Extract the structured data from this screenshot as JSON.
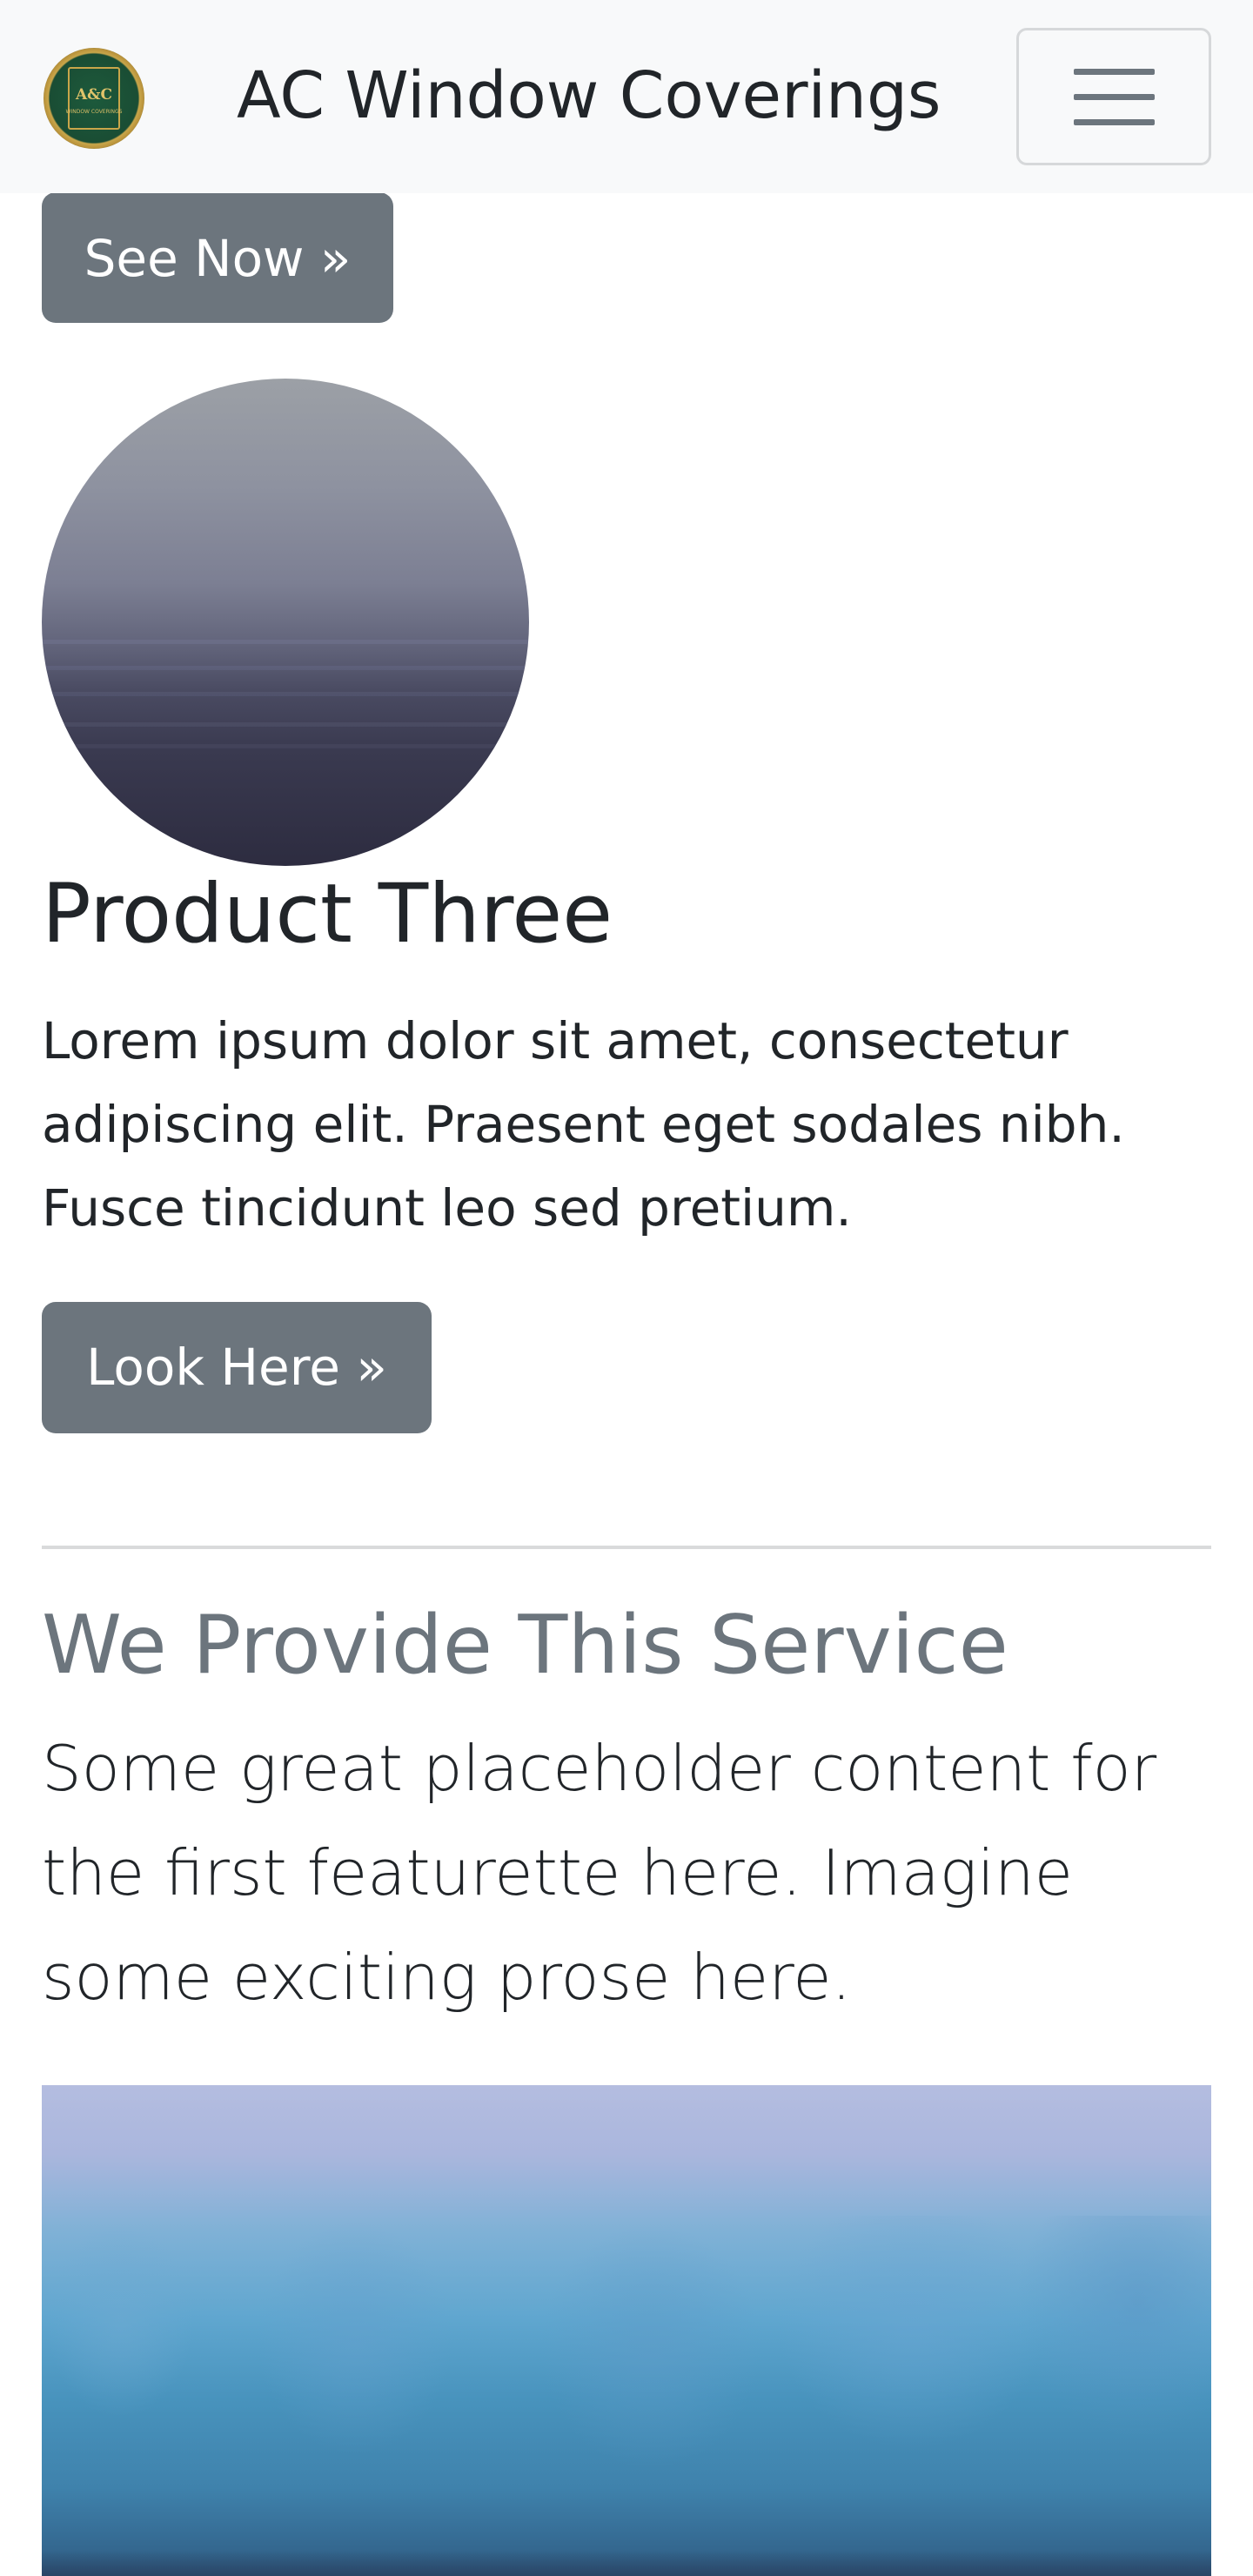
{
  "navbar": {
    "brand_name": "AC Window Coverings",
    "logo": {
      "text": "A&C",
      "subtext": "WINDOW COVERINGS"
    },
    "toggler_icon": "hamburger-menu-icon"
  },
  "buttons": {
    "see_now": "See Now »",
    "look_here": "Look Here »"
  },
  "product": {
    "title": "Product Three",
    "description": "Lorem ipsum dolor sit amet, consectetur adipiscing elit. Praesent eget sodales nibh. Fusce tincidunt leo sed pretium."
  },
  "featurette": {
    "heading": "We Provide This Service",
    "lead": "Some great placeholder content for the first featurette here. Imagine some exciting prose here."
  },
  "colors": {
    "navbar_bg": "#f8f9fa",
    "button_secondary": "#6c757d",
    "heading_muted": "#6c757d",
    "logo_green": "#1a4d34",
    "logo_gold": "#c9a64a"
  }
}
